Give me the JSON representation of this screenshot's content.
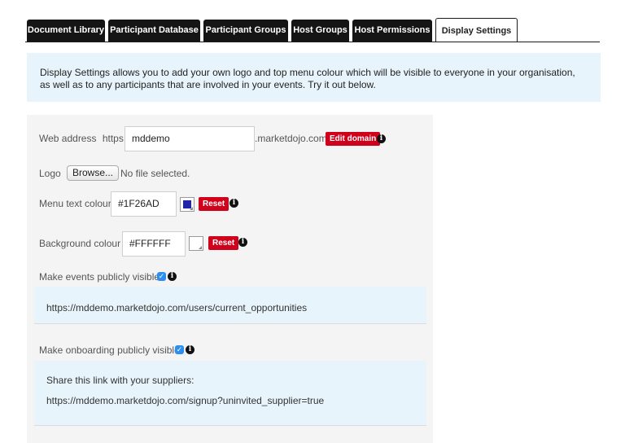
{
  "tabs": [
    {
      "label": "Document Library"
    },
    {
      "label": "Participant Database"
    },
    {
      "label": "Participant Groups"
    },
    {
      "label": "Host Groups"
    },
    {
      "label": "Host Permissions"
    },
    {
      "label": "Display Settings",
      "active": true
    }
  ],
  "intro": {
    "text": "Display Settings allows you to add your own logo and top menu colour which will be visible to everyone in your organisation, as well as to any participants that are involved in your events. Try it out below."
  },
  "web_address": {
    "label": "Web address",
    "prefix": "https://",
    "value": "mddemo",
    "suffix": ".marketdojo.com",
    "edit_button": "Edit domain"
  },
  "logo": {
    "label": "Logo",
    "browse_button": "Browse...",
    "file_status": "No file selected."
  },
  "menu_text_colour": {
    "label": "Menu text colour",
    "value": "#1F26AD",
    "swatch_color": "#1F26AD",
    "reset_button": "Reset"
  },
  "background_colour": {
    "label": "Background colour",
    "value": "#FFFFFF",
    "swatch_color": "#FFFFFF",
    "reset_button": "Reset"
  },
  "public_events": {
    "label": "Make events publicly visible",
    "checked": true,
    "link": "https://mddemo.marketdojo.com/users/current_opportunities"
  },
  "public_onboarding": {
    "label": "Make onboarding publicly visible",
    "checked": true,
    "share_text": "Share this link with your suppliers:",
    "link": "https://mddemo.marketdojo.com/signup?uninvited_supplier=true"
  },
  "colors": {
    "accent_red": "#D0021B",
    "tab_dark": "#151515",
    "info_panel": "#E8F4FB",
    "checkbox_blue": "#2D8EF0"
  }
}
